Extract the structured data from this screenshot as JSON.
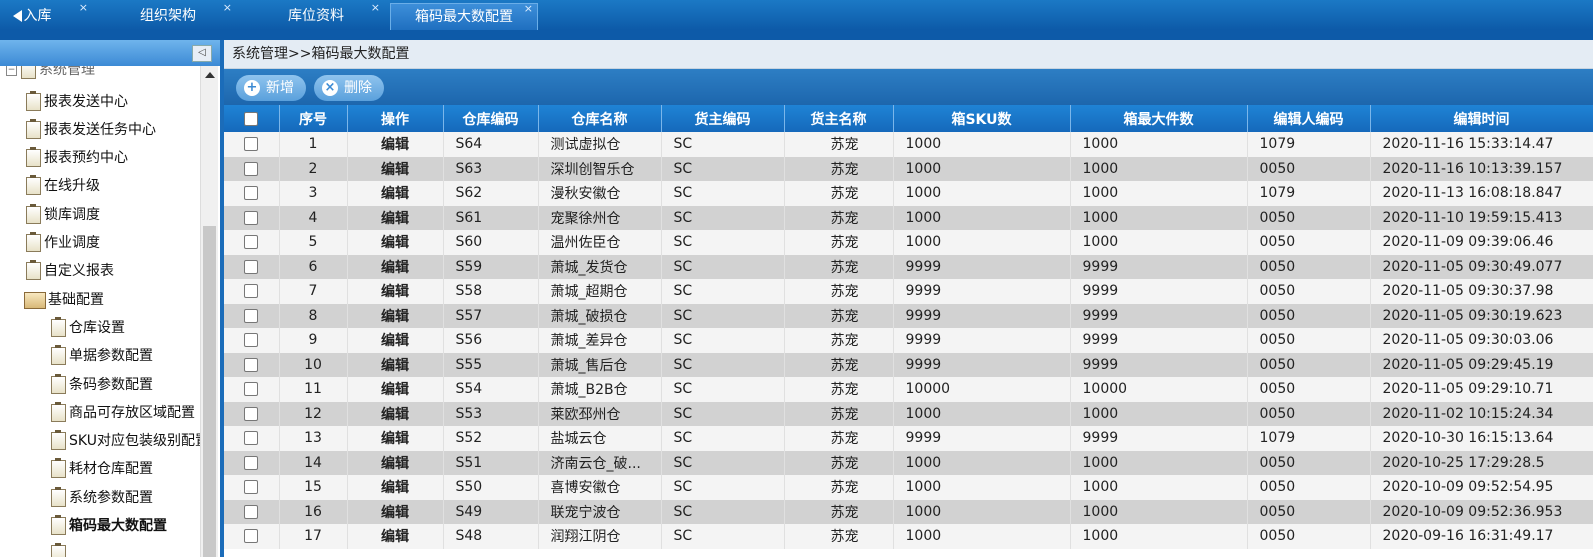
{
  "tabs": [
    {
      "label": "入库",
      "close": "×"
    },
    {
      "label": "组织架构",
      "close": "×"
    },
    {
      "label": "库位资料",
      "close": "×"
    },
    {
      "label": "箱码最大数配置",
      "close": "×"
    }
  ],
  "sidebar": {
    "collapse_label": "◁",
    "items": [
      {
        "label": "系统管理"
      },
      {
        "label": "报表发送中心"
      },
      {
        "label": "报表发送任务中心"
      },
      {
        "label": "报表预约中心"
      },
      {
        "label": "在线升级"
      },
      {
        "label": "锁库调度"
      },
      {
        "label": "作业调度"
      },
      {
        "label": "自定义报表"
      },
      {
        "label": "基础配置"
      },
      {
        "label": "仓库设置"
      },
      {
        "label": "单据参数配置"
      },
      {
        "label": "条码参数配置"
      },
      {
        "label": "商品可存放区域配置"
      },
      {
        "label": "SKU对应包装级别配置"
      },
      {
        "label": "耗材仓库配置"
      },
      {
        "label": "系统参数配置"
      },
      {
        "label": "箱码最大数配置"
      }
    ]
  },
  "breadcrumb": "系统管理>>箱码最大数配置",
  "toolbar": {
    "add_label": "新增",
    "delete_label": "删除",
    "add_symbol": "+",
    "delete_symbol": "×"
  },
  "table": {
    "headers": [
      "",
      "序号",
      "操作",
      "仓库编码",
      "仓库名称",
      "货主编码",
      "货主名称",
      "箱SKU数",
      "箱最大件数",
      "编辑人编码",
      "编辑时间"
    ],
    "rows": [
      [
        "1",
        "编辑",
        "S64",
        "测试虚拟仓",
        "SC",
        "苏宠",
        "1000",
        "1000",
        "1079",
        "2020-11-16 15:33:14.47"
      ],
      [
        "2",
        "编辑",
        "S63",
        "深圳创智乐仓",
        "SC",
        "苏宠",
        "1000",
        "1000",
        "0050",
        "2020-11-16 10:13:39.157"
      ],
      [
        "3",
        "编辑",
        "S62",
        "漫秋安徽仓",
        "SC",
        "苏宠",
        "1000",
        "1000",
        "1079",
        "2020-11-13 16:08:18.847"
      ],
      [
        "4",
        "编辑",
        "S61",
        "宠聚徐州仓",
        "SC",
        "苏宠",
        "1000",
        "1000",
        "0050",
        "2020-11-10 19:59:15.413"
      ],
      [
        "5",
        "编辑",
        "S60",
        "温州佐臣仓",
        "SC",
        "苏宠",
        "1000",
        "1000",
        "0050",
        "2020-11-09 09:39:06.46"
      ],
      [
        "6",
        "编辑",
        "S59",
        "萧城_发货仓",
        "SC",
        "苏宠",
        "9999",
        "9999",
        "0050",
        "2020-11-05 09:30:49.077"
      ],
      [
        "7",
        "编辑",
        "S58",
        "萧城_超期仓",
        "SC",
        "苏宠",
        "9999",
        "9999",
        "0050",
        "2020-11-05 09:30:37.98"
      ],
      [
        "8",
        "编辑",
        "S57",
        "萧城_破损仓",
        "SC",
        "苏宠",
        "9999",
        "9999",
        "0050",
        "2020-11-05 09:30:19.623"
      ],
      [
        "9",
        "编辑",
        "S56",
        "萧城_差异仓",
        "SC",
        "苏宠",
        "9999",
        "9999",
        "0050",
        "2020-11-05 09:30:03.06"
      ],
      [
        "10",
        "编辑",
        "S55",
        "萧城_售后仓",
        "SC",
        "苏宠",
        "9999",
        "9999",
        "0050",
        "2020-11-05 09:29:45.19"
      ],
      [
        "11",
        "编辑",
        "S54",
        "萧城_B2B仓",
        "SC",
        "苏宠",
        "10000",
        "10000",
        "0050",
        "2020-11-05 09:29:10.71"
      ],
      [
        "12",
        "编辑",
        "S53",
        "莱欧邳州仓",
        "SC",
        "苏宠",
        "1000",
        "1000",
        "0050",
        "2020-11-02 10:15:24.34"
      ],
      [
        "13",
        "编辑",
        "S52",
        "盐城云仓",
        "SC",
        "苏宠",
        "9999",
        "9999",
        "1079",
        "2020-10-30 16:15:13.64"
      ],
      [
        "14",
        "编辑",
        "S51",
        "济南云仓_破...",
        "SC",
        "苏宠",
        "1000",
        "1000",
        "0050",
        "2020-10-25 17:29:28.5"
      ],
      [
        "15",
        "编辑",
        "S50",
        "喜博安徽仓",
        "SC",
        "苏宠",
        "1000",
        "1000",
        "0050",
        "2020-10-09 09:52:54.95"
      ],
      [
        "16",
        "编辑",
        "S49",
        "联宠宁波仓",
        "SC",
        "苏宠",
        "1000",
        "1000",
        "0050",
        "2020-10-09 09:52:36.953"
      ],
      [
        "17",
        "编辑",
        "S48",
        "润翔江阴仓",
        "SC",
        "苏宠",
        "1000",
        "1000",
        "0050",
        "2020-09-16 16:31:49.17"
      ]
    ]
  }
}
